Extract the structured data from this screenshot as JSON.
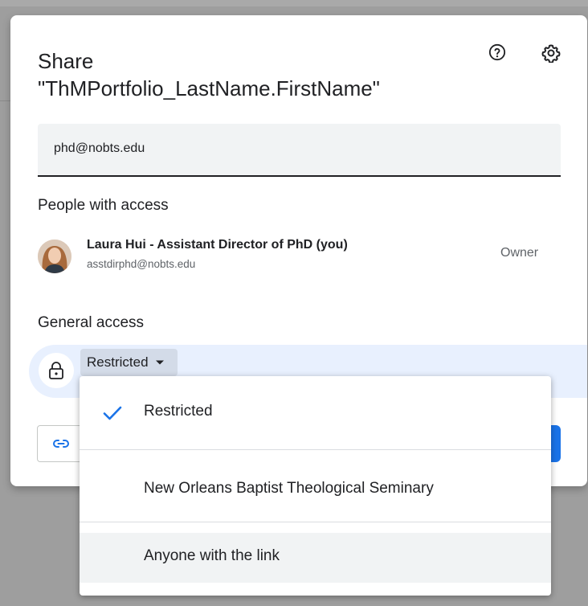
{
  "dialog": {
    "title": "Share\n\"ThMPortfolio_LastName.FirstName\"",
    "icons": {
      "help": "help-circle-icon",
      "settings": "gear-icon"
    }
  },
  "share_input": {
    "value": "phd@nobts.edu"
  },
  "people_with_access": {
    "heading": "People with access",
    "people": [
      {
        "name": "Laura Hui - Assistant Director of PhD (you)",
        "email": "asstdirphd@nobts.edu",
        "role": "Owner"
      }
    ]
  },
  "general_access": {
    "heading": "General access",
    "selected": "Restricted",
    "options": [
      {
        "label": "Restricted",
        "selected": true
      },
      {
        "label": "New Orleans Baptist Theological Seminary",
        "selected": false
      },
      {
        "label": "Anyone with the link",
        "selected": false,
        "hovered": true
      }
    ]
  },
  "colors": {
    "accent": "#1a73e8",
    "access_row_bg": "#e8f0fe",
    "field_bg": "#f1f3f4"
  }
}
